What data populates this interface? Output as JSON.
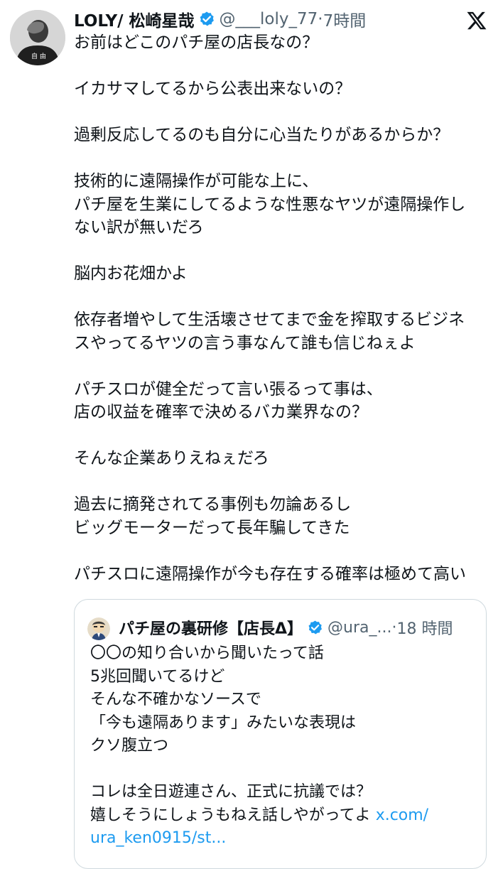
{
  "author": {
    "name": "LOLY/ 松崎星哉",
    "handle": "@___loly_77",
    "separator": "·",
    "time": "7時間"
  },
  "tweet": {
    "text": "お前はどこのパチ屋の店長なの？\n\nイカサマしてるから公表出来ないの？\n\n過剰反応してるのも自分に心当たりがあるからか？\n\n技術的に遠隔操作が可能な上に、\nパチ屋を生業にしてるような性悪なヤツが遠隔操作し\nない訳が無いだろ\n\n脳内お花畑かよ\n\n依存者増やして生活壊させてまで金を搾取するビジネ\nスやってるヤツの言う事なんて誰も信じねぇよ\n\nパチスロが健全だって言い張るって事は、\n店の収益を確率で決めるバカ業界なの？\n\nそんな企業ありえねぇだろ\n\n過去に摘発されてる事例も勿論あるし\nビッグモーターだって長年騙してきた\n\nパチスロに遠隔操作が今も存在する確率は極めて高い"
  },
  "quote": {
    "name": "パチ屋の裏研修【店長Δ】",
    "handle": "@ura_...",
    "separator": "·",
    "time": "18 時間",
    "text": "〇〇の知り合いから聞いたって話\n5兆回聞いてるけど\nそんな不確かなソースで\n「今も遠隔あります」みたいな表現は\nクソ腹立つ\n\nコレは全日遊連さん、正式に抗議では？\n嬉しそうにしょうもねえ話しやがってよ ",
    "link_part1": "x.com/",
    "link_part2": "ura_ken0915/st..."
  },
  "icons": {
    "verified": "verified-badge-icon",
    "brand": "x-logo-icon"
  },
  "colors": {
    "verified_blue": "#1d9bf0",
    "link_blue": "#1d9bf0",
    "muted_text": "#536471",
    "border": "#cfd9de"
  }
}
